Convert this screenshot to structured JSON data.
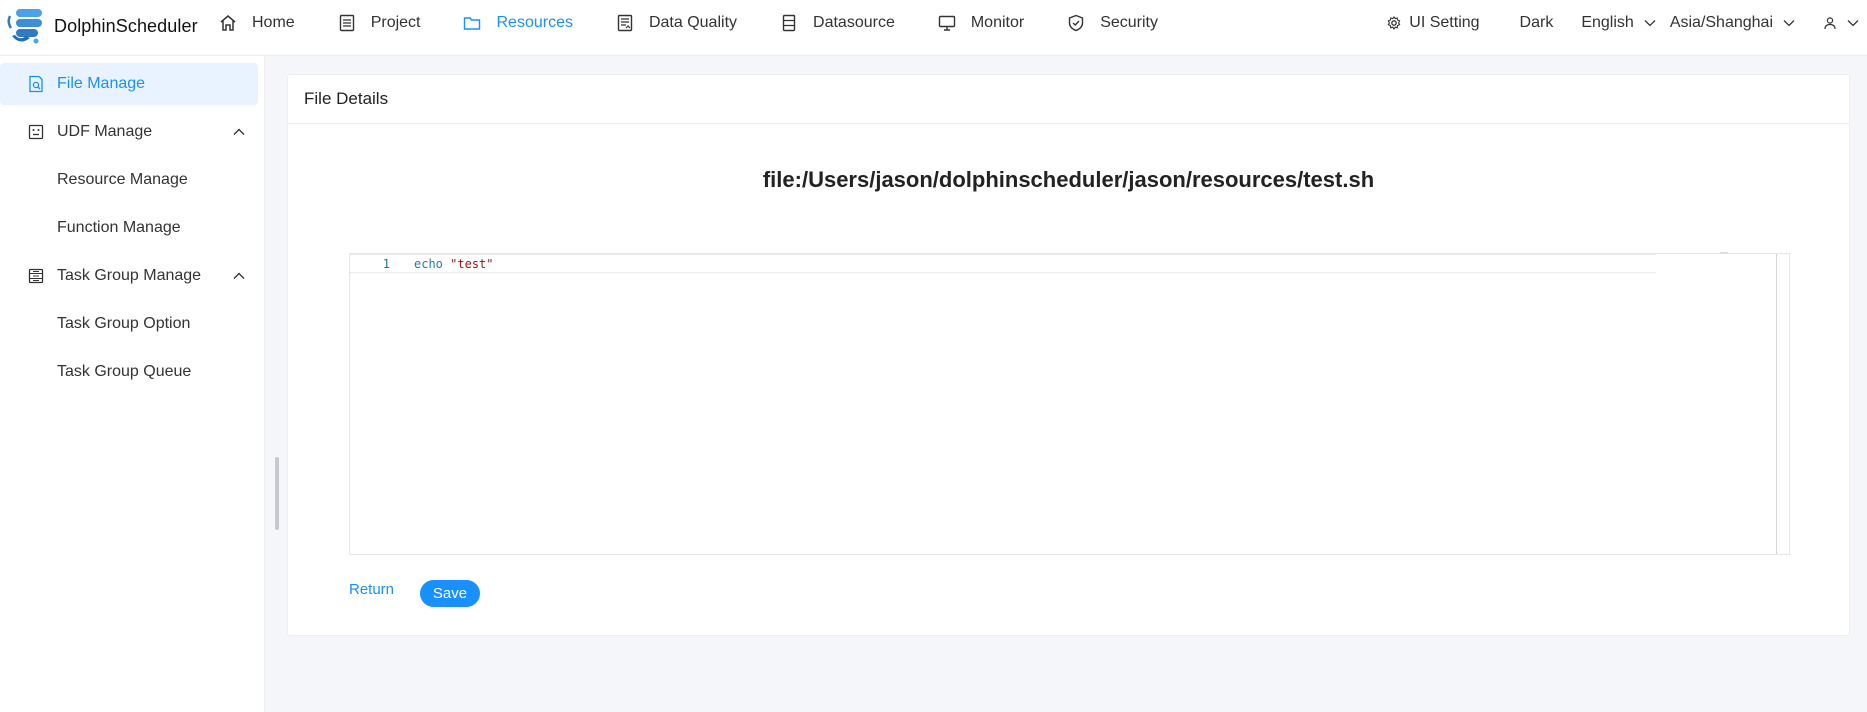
{
  "app": {
    "name": "DolphinScheduler"
  },
  "nav": {
    "items": [
      {
        "label": "Home",
        "icon": "home-icon"
      },
      {
        "label": "Project",
        "icon": "project-icon"
      },
      {
        "label": "Resources",
        "icon": "folder-icon",
        "active": true
      },
      {
        "label": "Data Quality",
        "icon": "data-quality-icon"
      },
      {
        "label": "Datasource",
        "icon": "datasource-icon"
      },
      {
        "label": "Monitor",
        "icon": "monitor-icon"
      },
      {
        "label": "Security",
        "icon": "shield-icon"
      }
    ],
    "ui_setting": "UI Setting",
    "theme": "Dark",
    "language": "English",
    "timezone": "Asia/Shanghai"
  },
  "sidebar": {
    "items": [
      {
        "label": "File Manage",
        "icon": "file-search-icon",
        "active": true
      },
      {
        "label": "UDF Manage",
        "icon": "udf-icon",
        "expanded": true,
        "children": [
          {
            "label": "Resource Manage"
          },
          {
            "label": "Function Manage"
          }
        ]
      },
      {
        "label": "Task Group Manage",
        "icon": "task-group-icon",
        "expanded": true,
        "children": [
          {
            "label": "Task Group Option"
          },
          {
            "label": "Task Group Queue"
          }
        ]
      }
    ]
  },
  "main": {
    "card_title": "File Details",
    "file_path": "file:/Users/jason/dolphinscheduler/jason/resources/test.sh",
    "editor": {
      "line_number": "1",
      "code_keyword": "echo",
      "code_string": "\"test\""
    },
    "return_label": "Return",
    "save_label": "Save"
  },
  "colors": {
    "accent": "#1890ff",
    "active_bg": "#e8f3ff",
    "page_bg": "#f5f6fa"
  }
}
